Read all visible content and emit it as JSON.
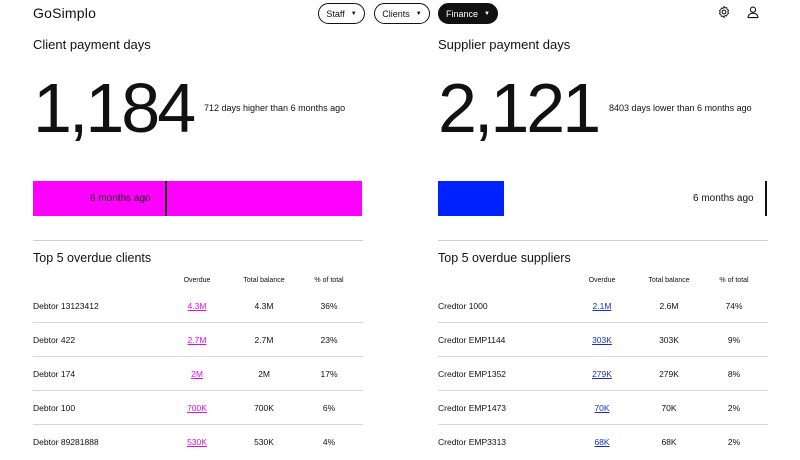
{
  "app": {
    "logo": "GoSimplo"
  },
  "nav": {
    "staff_label": "Staff",
    "clients_label": "Clients",
    "finance_label": "Finance",
    "caret": "▼"
  },
  "icons": {
    "settings": "gear-icon",
    "account": "user-icon"
  },
  "colors": {
    "client_accent": "#ff00ff",
    "supplier_accent": "#0022ff",
    "client_overdue_text": "#e010e0",
    "supplier_overdue_text": "#1530c8"
  },
  "client": {
    "title": "Client payment days",
    "value": "1,184",
    "delta_text": "712 days higher than 6 months ago",
    "bar_label": "6 months ago",
    "bar_current_fraction": 1.0,
    "bar_previous_fraction": 0.4,
    "section_title": "Top 5 overdue clients",
    "columns": [
      "Overdue",
      "Total balance",
      "% of total"
    ],
    "rows": [
      {
        "name": "Debtor 13123412",
        "overdue": "4.3M",
        "balance": "4.3M",
        "pct": "36%"
      },
      {
        "name": "Debtor 422",
        "overdue": "2.7M",
        "balance": "2.7M",
        "pct": "23%"
      },
      {
        "name": "Debtor 174",
        "overdue": "2M",
        "balance": "2M",
        "pct": "17%"
      },
      {
        "name": "Debtor 100",
        "overdue": "700K",
        "balance": "700K",
        "pct": "6%"
      },
      {
        "name": "Debtor 89281888",
        "overdue": "530K",
        "balance": "530K",
        "pct": "4%"
      }
    ]
  },
  "supplier": {
    "title": "Supplier payment days",
    "value": "2,121",
    "delta_text": "8403 days lower than 6 months ago",
    "bar_label": "6 months ago",
    "bar_current_fraction": 0.2,
    "bar_previous_fraction": 1.0,
    "section_title": "Top 5 overdue suppliers",
    "columns": [
      "Overdue",
      "Total balance",
      "% of total"
    ],
    "rows": [
      {
        "name": "Credtor 1000",
        "overdue": "2.1M",
        "balance": "2.6M",
        "pct": "74%"
      },
      {
        "name": "Credtor EMP1144",
        "overdue": "303K",
        "balance": "303K",
        "pct": "9%"
      },
      {
        "name": "Credtor EMP1352",
        "overdue": "279K",
        "balance": "279K",
        "pct": "8%"
      },
      {
        "name": "Credtor EMP1473",
        "overdue": "70K",
        "balance": "70K",
        "pct": "2%"
      },
      {
        "name": "Credtor EMP3313",
        "overdue": "68K",
        "balance": "68K",
        "pct": "2%"
      }
    ]
  }
}
